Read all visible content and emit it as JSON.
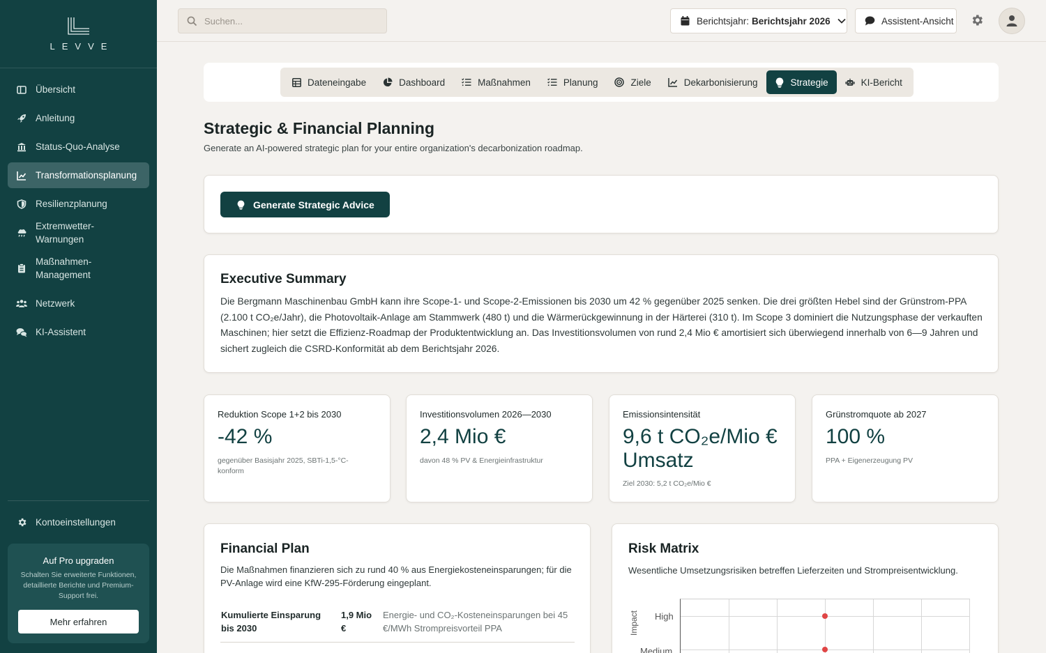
{
  "brand": {
    "name": "LEVVE"
  },
  "sidebar": {
    "items": [
      {
        "label": "Übersicht",
        "icon": "layout-icon"
      },
      {
        "label": "Anleitung",
        "icon": "rocket-icon"
      },
      {
        "label": "Status-Quo-Analyse",
        "icon": "bank-icon"
      },
      {
        "label": "Transformationsplanung",
        "icon": "chart-line-icon"
      },
      {
        "label": "Resilienzplanung",
        "icon": "shield-icon"
      },
      {
        "label": "Extremwetter-Warnungen",
        "icon": "cloud-rain-icon"
      },
      {
        "label": "Maßnahmen-Management",
        "icon": "clipboard-icon"
      },
      {
        "label": "Netzwerk",
        "icon": "users-icon"
      },
      {
        "label": "KI-Assistent",
        "icon": "chat-icon"
      }
    ],
    "active_index": 3,
    "account_label": "Kontoeinstellungen",
    "upgrade": {
      "title": "Auf Pro upgraden",
      "description": "Schalten Sie erweiterte Funktionen, detaillierte Berichte und Premium-Support frei.",
      "button": "Mehr erfahren"
    }
  },
  "topbar": {
    "search_placeholder": "Suchen...",
    "year_prefix": "Berichtsjahr:",
    "year_value": "Berichtsjahr 2026",
    "assistant_label": "Assistent-Ansicht"
  },
  "tabs": [
    {
      "label": "Dateneingabe",
      "icon": "table-icon"
    },
    {
      "label": "Dashboard",
      "icon": "pie-chart-icon"
    },
    {
      "label": "Maßnahmen",
      "icon": "list-check-icon"
    },
    {
      "label": "Planung",
      "icon": "list-check-icon"
    },
    {
      "label": "Ziele",
      "icon": "target-icon"
    },
    {
      "label": "Dekarbonisierung",
      "icon": "chart-line-icon"
    },
    {
      "label": "Strategie",
      "icon": "lightbulb-icon"
    },
    {
      "label": "KI-Bericht",
      "icon": "robot-icon"
    }
  ],
  "active_tab_index": 6,
  "page": {
    "title": "Strategic & Financial Planning",
    "subtitle": "Generate an AI-powered strategic plan for your entire organization's decarbonization roadmap.",
    "generate_button": "Generate Strategic Advice"
  },
  "summary": {
    "title": "Executive Summary",
    "text": "Die Bergmann Maschinenbau GmbH kann ihre Scope-1- und Scope-2-Emissionen bis 2030 um 42 % gegenüber 2025 senken. Die drei größten Hebel sind der Grünstrom-PPA (2.100 t CO₂e/Jahr), die Photovoltaik-Anlage am Stammwerk (480 t) und die Wärmerückgewinnung in der Härterei (310 t). Im Scope 3 dominiert die Nutzungsphase der verkauften Maschinen; hier setzt die Effizienz-Roadmap der Produktentwicklung an. Das Investitionsvolumen von rund 2,4 Mio € amortisiert sich überwiegend innerhalb von 6—9 Jahren und sichert zugleich die CSRD-Konformität ab dem Berichtsjahr 2026."
  },
  "kpis": [
    {
      "label": "Reduktion Scope 1+2 bis 2030",
      "value": "-42 %",
      "note": "gegenüber Basisjahr 2025, SBTi-1,5-°C-konform"
    },
    {
      "label": "Investitionsvolumen 2026—2030",
      "value": "2,4 Mio €",
      "note": "davon 48 % PV & Energieinfrastruktur"
    },
    {
      "label": "Emissionsintensität",
      "value": "9,6 t CO₂e/Mio € Umsatz",
      "note": "Ziel 2030: 5,2 t CO₂e/Mio €"
    },
    {
      "label": "Grünstromquote ab 2027",
      "value": "100 %",
      "note": "PPA + Eigenerzeugung PV"
    }
  ],
  "financial": {
    "title": "Financial Plan",
    "text": "Die Maßnahmen finanzieren sich zu rund 40 % aus Energiekosteneinsparungen; für die PV-Anlage wird eine KfW-295-Förderung eingeplant.",
    "rows": [
      {
        "label": "Kumulierte Einsparung bis 2030",
        "value": "1,9 Mio €",
        "description": "Energie- und CO₂-Kosteneinsparungen bei 45 €/MWh Strompreisvorteil PPA"
      }
    ]
  },
  "risk": {
    "title": "Risk Matrix",
    "text": "Wesentliche Umsetzungsrisiken betreffen Lieferzeiten und Strompreisentwicklung.",
    "y_axis_label": "Impact",
    "y_levels": [
      "High",
      "Medium"
    ],
    "points": [
      {
        "likelihood_col": 3,
        "impact": "High"
      },
      {
        "likelihood_col": 3,
        "impact": "Medium"
      }
    ],
    "point_color": "#e04545"
  },
  "colors": {
    "primary": "#124142",
    "sidebar": "#124142",
    "active_nav": "#3c6466",
    "background": "#f4f2ef"
  }
}
